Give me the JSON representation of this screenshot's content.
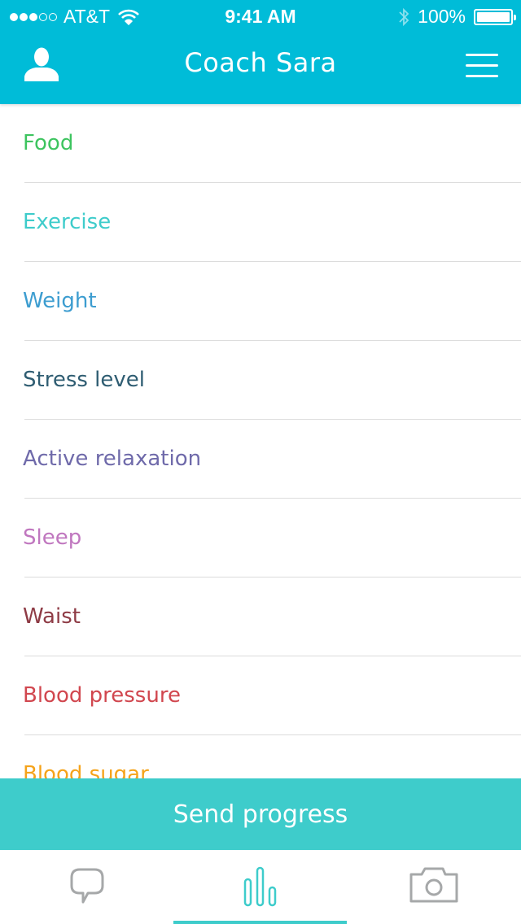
{
  "status_bar": {
    "carrier": "AT&T",
    "signal_bars_filled": 3,
    "signal_bars_total": 5,
    "time": "9:41 AM",
    "battery": "100%",
    "icons": [
      "signal-dots-icon",
      "wifi-icon",
      "bluetooth-icon",
      "battery-icon"
    ]
  },
  "navbar": {
    "title": "Coach Sara",
    "left_icon": "profile-icon",
    "right_icon": "hamburger-menu-icon"
  },
  "colors": {
    "brand": "#00bcd8",
    "accent": "#3ecccb",
    "inactive_icon": "#a6a8a9"
  },
  "categories": [
    {
      "label": "Food",
      "color": "#3dc45f"
    },
    {
      "label": "Exercise",
      "color": "#3ecccb"
    },
    {
      "label": "Weight",
      "color": "#3d9dd0"
    },
    {
      "label": "Stress level",
      "color": "#2f5d72"
    },
    {
      "label": "Active relaxation",
      "color": "#6f6aaa"
    },
    {
      "label": "Sleep",
      "color": "#c077bf"
    },
    {
      "label": "Waist",
      "color": "#8e3b45"
    },
    {
      "label": "Blood pressure",
      "color": "#d1474f"
    },
    {
      "label": "Blood sugar",
      "color": "#f5a31a"
    }
  ],
  "send_button": {
    "label": "Send progress"
  },
  "tabbar": {
    "tabs": [
      {
        "name": "chat",
        "icon": "speech-bubble-icon",
        "active": false
      },
      {
        "name": "progress",
        "icon": "bar-chart-icon",
        "active": true
      },
      {
        "name": "camera",
        "icon": "camera-icon",
        "active": false
      }
    ]
  }
}
